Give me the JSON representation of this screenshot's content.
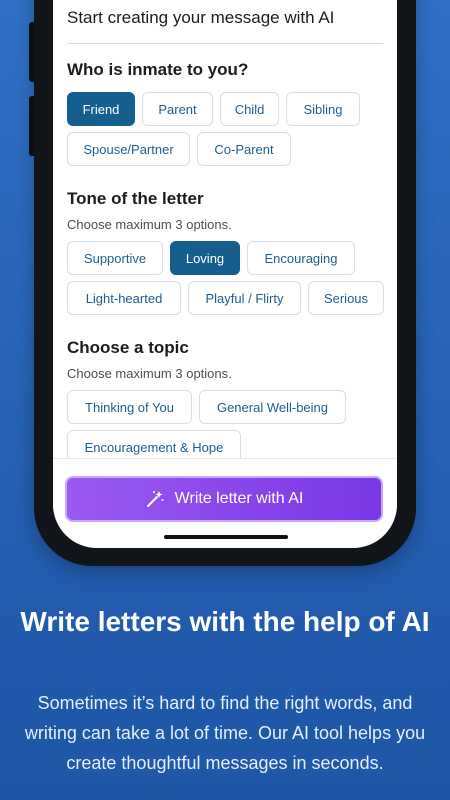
{
  "app": {
    "title": "Start creating your message with AI"
  },
  "relationship": {
    "title": "Who is inmate to you?",
    "options": [
      "Friend",
      "Parent",
      "Child",
      "Sibling",
      "Spouse/Partner",
      "Co-Parent"
    ],
    "selected": "Friend"
  },
  "tone": {
    "title": "Tone of the letter",
    "subtitle": "Choose maximum 3 options.",
    "options": [
      "Supportive",
      "Loving",
      "Encouraging",
      "Light-hearted",
      "Playful / Flirty",
      "Serious"
    ],
    "selected": [
      "Loving"
    ]
  },
  "topic": {
    "title": "Choose a topic",
    "subtitle": "Choose maximum 3 options.",
    "options": [
      "Thinking of You",
      "General Well-being",
      "Encouragement & Hope"
    ]
  },
  "action": {
    "label": "Write letter with AI",
    "icon": "magic-wand-icon"
  },
  "promo": {
    "headline": "Write letters with the help of AI",
    "body": "Sometimes it’s hard to find the right words, and writing can take a lot of time. Our AI tool helps you create thoughtful messages in seconds."
  },
  "colors": {
    "background": "#2a66bb",
    "chip_selected": "#155f8f",
    "chip_text": "#1f5e93",
    "button_start": "#9b59f0",
    "button_end": "#7a37e6"
  }
}
